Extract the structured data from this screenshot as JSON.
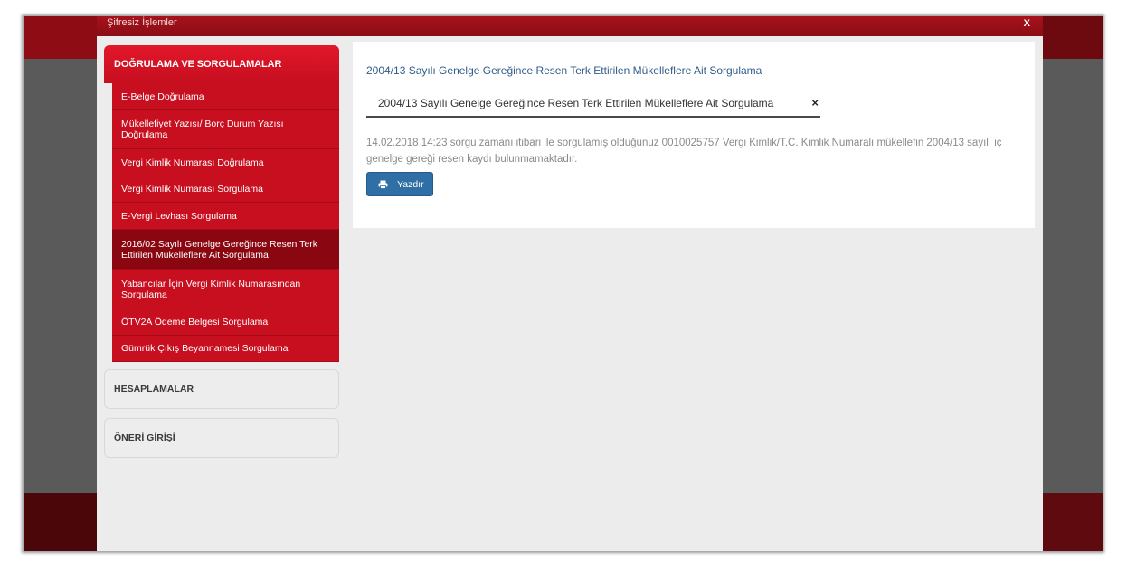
{
  "modal": {
    "title": "Şifresiz İşlemler",
    "close_label": "X"
  },
  "sidebar": {
    "section_title": "DOĞRULAMA VE SORGULAMALAR",
    "items": [
      {
        "label": "E-Belge Doğrulama"
      },
      {
        "label": "Mükellefiyet Yazısı/ Borç Durum Yazısı Doğrulama"
      },
      {
        "label": "Vergi Kimlik Numarası Doğrulama"
      },
      {
        "label": "Vergi Kimlik Numarası Sorgulama"
      },
      {
        "label": "E-Vergi Levhası Sorgulama"
      },
      {
        "label": "2016/02 Sayılı Genelge Gereğince Resen Terk Ettirilen Mükelleflere Ait Sorgulama"
      },
      {
        "label": "Yabancılar İçin Vergi Kimlik Numarasından Sorgulama"
      },
      {
        "label": "ÖTV2A Ödeme Belgesi Sorgulama"
      },
      {
        "label": "Gümrük Çıkış Beyannamesi Sorgulama"
      }
    ],
    "panels": [
      {
        "label": "HESAPLAMALAR"
      },
      {
        "label": "ÖNERİ GİRİŞİ"
      }
    ]
  },
  "content": {
    "link_title": "2004/13 Sayılı Genelge Gereğince Resen Terk Ettirilen Mükelleflere Ait Sorgulama",
    "tab_label": "2004/13 Sayılı Genelge Gereğince Resen Terk Ettirilen Mükelleflere Ait Sorgulama",
    "tab_close": "×",
    "message": "14.02.2018 14:23 sorgu zamanı itibari ile sorgulamış olduğunuz 0010025757 Vergi Kimlik/T.C. Kimlik Numaralı mükellefin 2004/13 sayılı iç genelge gereği resen kaydı bulunmamaktadır.",
    "print_label": "Yazdır"
  },
  "colors": {
    "brand_red": "#c80f1f",
    "active_red": "#8a0711",
    "button_blue": "#2f6fa6",
    "link_blue": "#2f5c8a"
  }
}
